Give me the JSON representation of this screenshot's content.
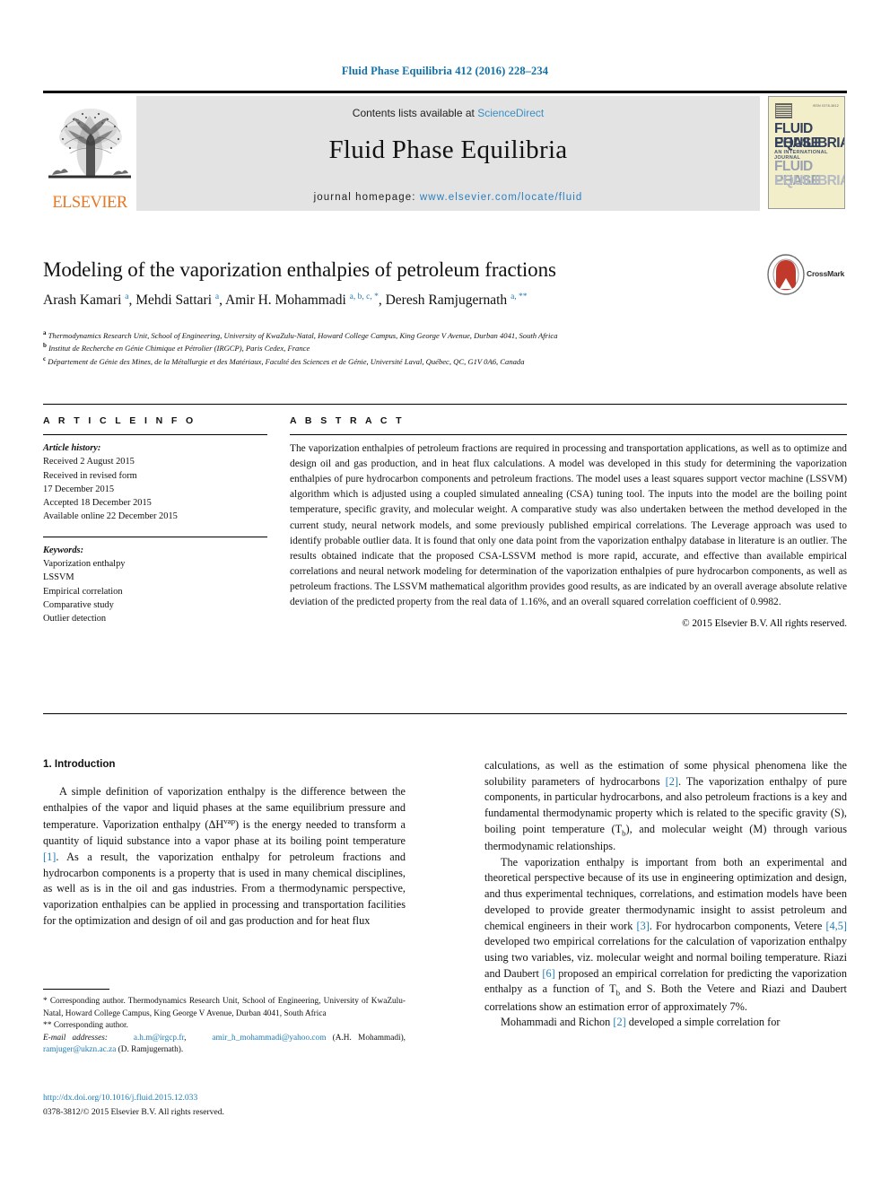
{
  "running_head": "Fluid Phase Equilibria 412 (2016) 228–234",
  "masthead": {
    "contents_prefix": "Contents lists available at ",
    "sciencedirect": "ScienceDirect",
    "journal_name": "Fluid Phase Equilibria",
    "homepage_prefix": "journal homepage: ",
    "homepage_url": "www.elsevier.com/locate/fluid",
    "publisher_word": "ELSEVIER",
    "cover": {
      "line1": "FLUID PHASE",
      "line2": "EQUILIBRIA",
      "line3": "AN INTERNATIONAL JOURNAL",
      "line4": "FLUID PHASE",
      "line5": "EQUILIBRIA",
      "issn": "ISSN 0378-3812"
    }
  },
  "article": {
    "title": "Modeling of the vaporization enthalpies of petroleum fractions",
    "authors_html": "Arash Kamari <sup>a</sup>, Mehdi Sattari <sup>a</sup>, Amir H. Mohammadi <sup>a, b, c, *</sup>, Deresh Ramjugernath <sup>a, **</sup>",
    "affiliations": [
      "Thermodynamics Research Unit, School of Engineering, University of KwaZulu-Natal, Howard College Campus, King George V Avenue, Durban 4041, South Africa",
      "Institut de Recherche en Génie Chimique et Pétrolier (IRGCP), Paris Cedex, France",
      "Département de Génie des Mines, de la Métallurgie et des Matériaux, Faculté des Sciences et de Génie, Université Laval, Québec, QC, G1V 0A6, Canada"
    ],
    "crossmark_label": "CrossMark"
  },
  "article_info": {
    "heading": "A R T I C L E   I N F O",
    "history_label": "Article history:",
    "history": [
      "Received 2 August 2015",
      "Received in revised form",
      "17 December 2015",
      "Accepted 18 December 2015",
      "Available online 22 December 2015"
    ],
    "keywords_label": "Keywords:",
    "keywords": [
      "Vaporization enthalpy",
      "LSSVM",
      "Empirical correlation",
      "Comparative study",
      "Outlier detection"
    ]
  },
  "abstract": {
    "heading": "A B S T R A C T",
    "text": "The vaporization enthalpies of petroleum fractions are required in processing and transportation applications, as well as to optimize and design oil and gas production, and in heat flux calculations. A model was developed in this study for determining the vaporization enthalpies of pure hydrocarbon components and petroleum fractions. The model uses a least squares support vector machine (LSSVM) algorithm which is adjusted using a coupled simulated annealing (CSA) tuning tool. The inputs into the model are the boiling point temperature, specific gravity, and molecular weight. A comparative study was also undertaken between the method developed in the current study, neural network models, and some previously published empirical correlations. The Leverage approach was used to identify probable outlier data. It is found that only one data point from the vaporization enthalpy database in literature is an outlier. The results obtained indicate that the proposed CSA-LSSVM method is more rapid, accurate, and effective than available empirical correlations and neural network modeling for determination of the vaporization enthalpies of pure hydrocarbon components, as well as petroleum fractions. The LSSVM mathematical algorithm provides good results, as are indicated by an overall average absolute relative deviation of the predicted property from the real data of 1.16%, and an overall squared correlation coefficient of 0.9982.",
    "copyright": "© 2015 Elsevier B.V. All rights reserved."
  },
  "body": {
    "section_heading": "1. Introduction",
    "left_p1_html": "A simple definition of vaporization enthalpy is the difference between the enthalpies of the vapor and liquid phases at the same equilibrium pressure and temperature. Vaporization enthalpy (ΔH<sup class=\"sm\">vap</sup>) is the energy needed to transform a quantity of liquid substance into a vapor phase at its boiling point temperature <span class=\"ref\">[1]</span>. As a result, the vaporization enthalpy for petroleum fractions and hydrocarbon components is a property that is used in many chemical disciplines, as well as is in the oil and gas industries. From a thermodynamic perspective, vaporization enthalpies can be applied in processing and transportation facilities for the optimization and design of oil and gas production and for heat flux",
    "right_p1_html": "calculations, as well as the estimation of some physical phenomena like the solubility parameters of hydrocarbons <span class=\"ref\">[2]</span>. The vaporization enthalpy of pure components, in particular hydrocarbons, and also petroleum fractions is a key and fundamental thermodynamic property which is related to the specific gravity (S), boiling point temperature (T<sub>b</sub>), and molecular weight (M) through various thermodynamic relationships.",
    "right_p2_html": "The vaporization enthalpy is important from both an experimental and theoretical perspective because of its use in engineering optimization and design, and thus experimental techniques, correlations, and estimation models have been developed to provide greater thermodynamic insight to assist petroleum and chemical engineers in their work <span class=\"ref\">[3]</span>. For hydrocarbon components, Vetere <span class=\"ref\">[4,5]</span> developed two empirical correlations for the calculation of vaporization enthalpy using two variables, viz. molecular weight and normal boiling temperature. Riazi and Daubert <span class=\"ref\">[6]</span> proposed an empirical correlation for predicting the vaporization enthalpy as a function of T<sub>b</sub> and S. Both the Vetere and Riazi and Daubert correlations show an estimation error of approximately 7%.",
    "right_p3_html": "Mohammadi and Richon <span class=\"ref\">[2]</span> developed a simple correlation for"
  },
  "footnotes": {
    "note1_html": "<span class=\"star\">*</span> Corresponding author. Thermodynamics Research Unit, School of Engineering, University of KwaZulu-Natal, Howard College Campus, King George V Avenue, Durban 4041, South Africa",
    "note2_html": "<span class=\"star\">**</span> Corresponding author.",
    "emails_html": "<i>E-mail addresses:</i> &nbsp;&nbsp;&nbsp;<span class=\"link\">a.h.m@irgcp.fr</span>, &nbsp;&nbsp;&nbsp;<span class=\"link\">amir_h_mohammadi@yahoo.com</span> (A.H. Mohammadi), <span class=\"link\">ramjuger@ukzn.ac.za</span> (D. Ramjugernath).",
    "doi": "http://dx.doi.org/10.1016/j.fluid.2015.12.033",
    "issn_line": "0378-3812/© 2015 Elsevier B.V. All rights reserved."
  },
  "colors": {
    "link_blue": "#1f7cb4",
    "running_head_blue": "#1170a8",
    "elsevier_orange": "#e87722",
    "band_gray": "#e3e3e3"
  }
}
